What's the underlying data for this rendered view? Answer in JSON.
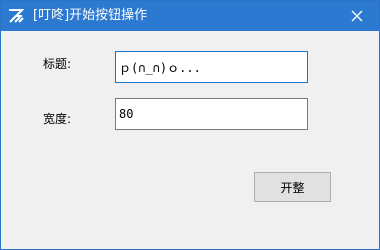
{
  "window": {
    "title": "[叮咚]开始按钮操作",
    "app_icon": "app-logo-icon",
    "close_icon": "close-icon",
    "titlebar_color": "#2b79d0"
  },
  "form": {
    "title_label": "标题:",
    "title_value": "ｐ(∩_∩)ｏ...",
    "width_label": "宽度:",
    "width_value": "80"
  },
  "buttons": {
    "start_label": "开整"
  }
}
